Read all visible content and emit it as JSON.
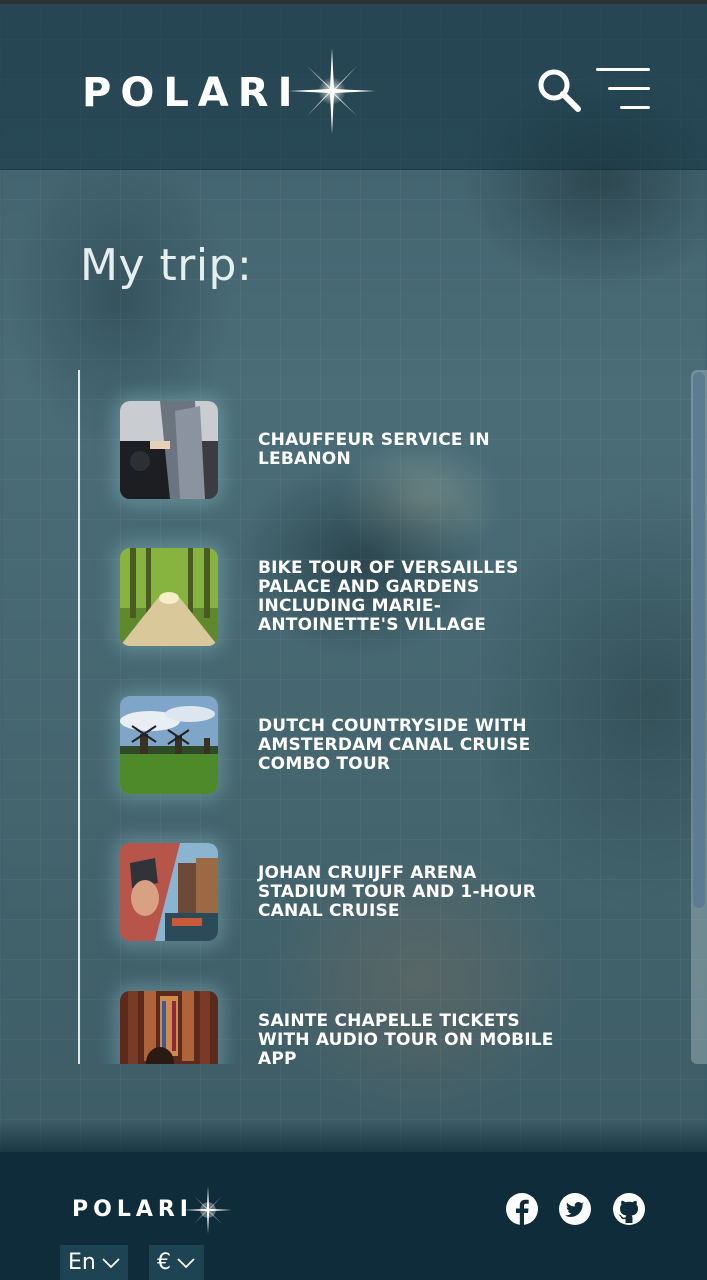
{
  "header": {
    "logo_text": "POLARI",
    "search_icon": "search-icon",
    "menu_icon": "hamburger-menu-icon"
  },
  "page": {
    "title": "My trip:"
  },
  "trips": [
    {
      "title": "CHAUFFEUR SERVICE IN LEBANON",
      "image": "chauffeur-photo"
    },
    {
      "title": "BIKE TOUR OF VERSAILLES PALACE AND GARDENS INCLUDING MARIE-ANTOINETTE'S VILLAGE",
      "image": "tree-lined-path-photo"
    },
    {
      "title": "DUTCH COUNTRYSIDE WITH AMSTERDAM CANAL CRUISE COMBO TOUR",
      "image": "windmills-photo"
    },
    {
      "title": "JOHAN CRUIJFF ARENA STADIUM TOUR AND 1-HOUR CANAL CRUISE",
      "image": "stadium-canal-photo"
    },
    {
      "title": "SAINTE CHAPELLE TICKETS WITH AUDIO TOUR ON MOBILE APP",
      "image": "chapel-interior-photo"
    }
  ],
  "footer": {
    "logo_text": "POLARI",
    "social": [
      "facebook-icon",
      "twitter-icon",
      "github-icon"
    ],
    "language": "En",
    "currency": "€"
  },
  "colors": {
    "header_bg": "#123240",
    "footer_bg": "#0f2c3a",
    "scroll_thumb": "#5d7c92"
  }
}
